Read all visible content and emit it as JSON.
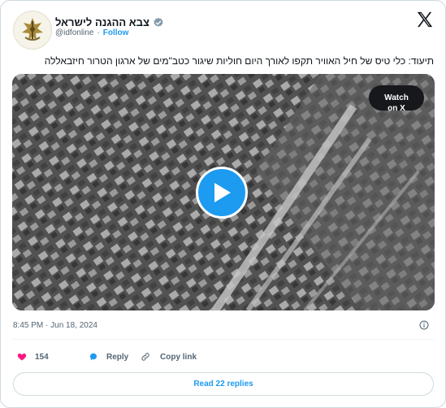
{
  "author": {
    "display_name": "צבא ההגנה לישראל",
    "handle": "@idfonline",
    "separator": "·",
    "follow_label": "Follow"
  },
  "tweet": {
    "text": "תיעוד: כלי טיס של חיל האוויר תקפו לאורך היום חוליות שיגור כטב\"מים של ארגון הטרור חיזבאללה",
    "timestamp": "8:45 PM · Jun 18, 2024"
  },
  "media": {
    "watch_label": "Watch on X"
  },
  "actions": {
    "like_count": "154",
    "reply_label": "Reply",
    "copy_link_label": "Copy link"
  },
  "footer": {
    "read_replies_label": "Read 22 replies"
  },
  "colors": {
    "accent": "#1d9bf0",
    "like": "#f91880",
    "text": "#0f1419",
    "muted": "#536471",
    "border": "#cfd9de"
  },
  "icons": [
    "idf-logo-avatar",
    "verified-badge-icon",
    "x-logo-icon",
    "play-icon",
    "info-icon",
    "heart-icon",
    "reply-icon",
    "link-icon"
  ]
}
